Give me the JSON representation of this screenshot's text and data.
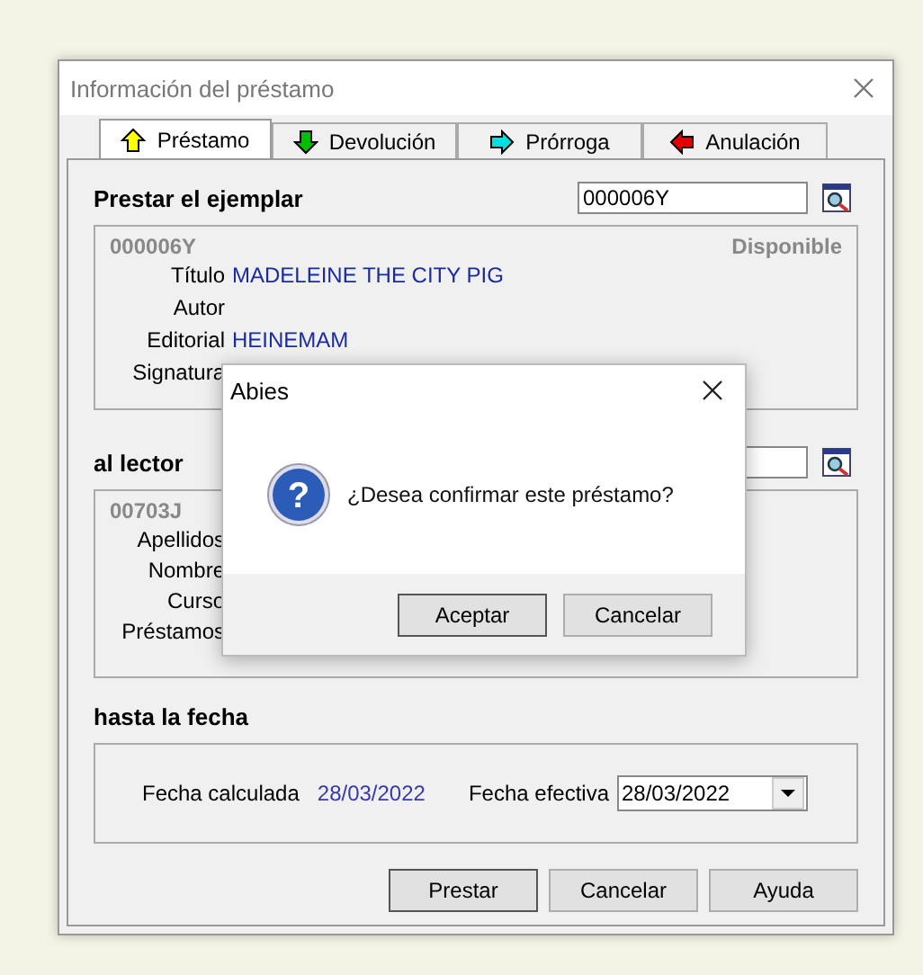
{
  "window": {
    "title": "Información del préstamo"
  },
  "tabs": [
    {
      "label": "Préstamo",
      "selected": true,
      "kind": "up",
      "color": "#ffff00"
    },
    {
      "label": "Devolución",
      "selected": false,
      "kind": "down",
      "color": "#00c000"
    },
    {
      "label": "Prórroga",
      "selected": false,
      "kind": "right",
      "color": "#00e0e0"
    },
    {
      "label": "Anulación",
      "selected": false,
      "kind": "left",
      "color": "#e00000"
    }
  ],
  "copy": {
    "heading": "Prestar el ejemplar",
    "search_value": "000006Y",
    "code": "000006Y",
    "status": "Disponible",
    "fields": [
      {
        "label": "Título",
        "value": "MADELEINE THE CITY PIG"
      },
      {
        "label": "Autor"
      },
      {
        "label": "Editorial",
        "value": "HEINEMAM"
      },
      {
        "label": "Signatura"
      }
    ]
  },
  "reader": {
    "heading": "al lector",
    "code": "00703J",
    "fields": [
      {
        "label": "Apellidos"
      },
      {
        "label": "Nombre"
      },
      {
        "label": "Curso"
      },
      {
        "label": "Préstamos"
      }
    ]
  },
  "date": {
    "heading": "hasta la fecha",
    "calculated_label": "Fecha calculada",
    "calculated_value": "28/03/2022",
    "effective_label": "Fecha efectiva",
    "effective_value": "28/03/2022"
  },
  "buttons": [
    "Prestar",
    "Cancelar",
    "Ayuda"
  ],
  "dialog": {
    "title": "Abies",
    "icon_glyph": "?",
    "message": "¿Desea confirmar este préstamo?",
    "buttons": [
      "Aceptar",
      "Cancelar"
    ]
  }
}
